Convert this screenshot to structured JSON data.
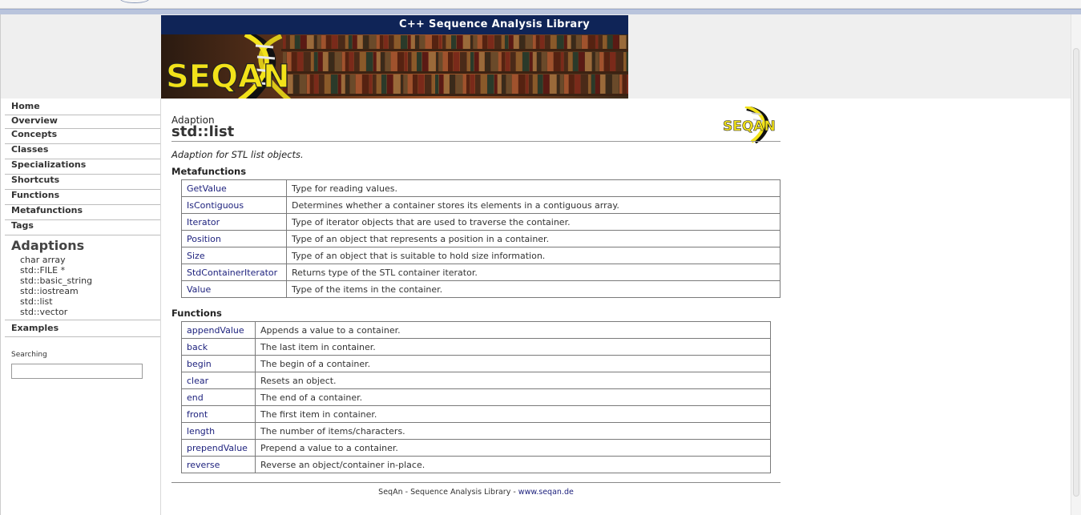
{
  "banner": {
    "title": "C++ Sequence Analysis Library",
    "logo_text": "SEQAN"
  },
  "sidebar": {
    "nav": [
      "Home",
      "Overview",
      "Concepts",
      "Classes",
      "Specializations",
      "Shortcuts",
      "Functions",
      "Metafunctions",
      "Tags"
    ],
    "adaptions_heading": "Adaptions",
    "adaptions": [
      "char array",
      "std::FILE *",
      "std::basic_string",
      "std::iostream",
      "std::list",
      "std::vector"
    ],
    "examples": "Examples",
    "search_label": "Searching",
    "search_value": ""
  },
  "page": {
    "kind": "Adaption",
    "title": "std::list",
    "summary": "Adaption for STL list objects.",
    "logo_small_text": "SEQAN"
  },
  "metafunctions": {
    "heading": "Metafunctions",
    "rows": [
      {
        "name": "GetValue",
        "desc": "Type for reading values."
      },
      {
        "name": "IsContiguous",
        "desc": "Determines whether a container stores its elements in a contiguous array."
      },
      {
        "name": "Iterator",
        "desc": "Type of iterator objects that are used to traverse the container."
      },
      {
        "name": "Position",
        "desc": "Type of an object that represents a position in a container."
      },
      {
        "name": "Size",
        "desc": "Type of an object that is suitable to hold size information."
      },
      {
        "name": "StdContainerIterator",
        "desc": "Returns type of the STL container iterator."
      },
      {
        "name": "Value",
        "desc": "Type of the items in the container."
      }
    ]
  },
  "functions": {
    "heading": "Functions",
    "rows": [
      {
        "name": "appendValue",
        "desc": "Appends a value to a container."
      },
      {
        "name": "back",
        "desc": "The last item in container."
      },
      {
        "name": "begin",
        "desc": "The begin of a container."
      },
      {
        "name": "clear",
        "desc": "Resets an object."
      },
      {
        "name": "end",
        "desc": "The end of a container."
      },
      {
        "name": "front",
        "desc": "The first item in container."
      },
      {
        "name": "length",
        "desc": "The number of items/characters."
      },
      {
        "name": "prependValue",
        "desc": "Prepend a value to a container."
      },
      {
        "name": "reverse",
        "desc": "Reverse an object/container in-place."
      }
    ]
  },
  "footer": {
    "text": "SeqAn - Sequence Analysis Library - ",
    "link": "www.seqan.de"
  },
  "colors": {
    "banner_bar": "#0f2457",
    "link": "#1b1f7c",
    "logo_yellow": "#f2e21a"
  }
}
